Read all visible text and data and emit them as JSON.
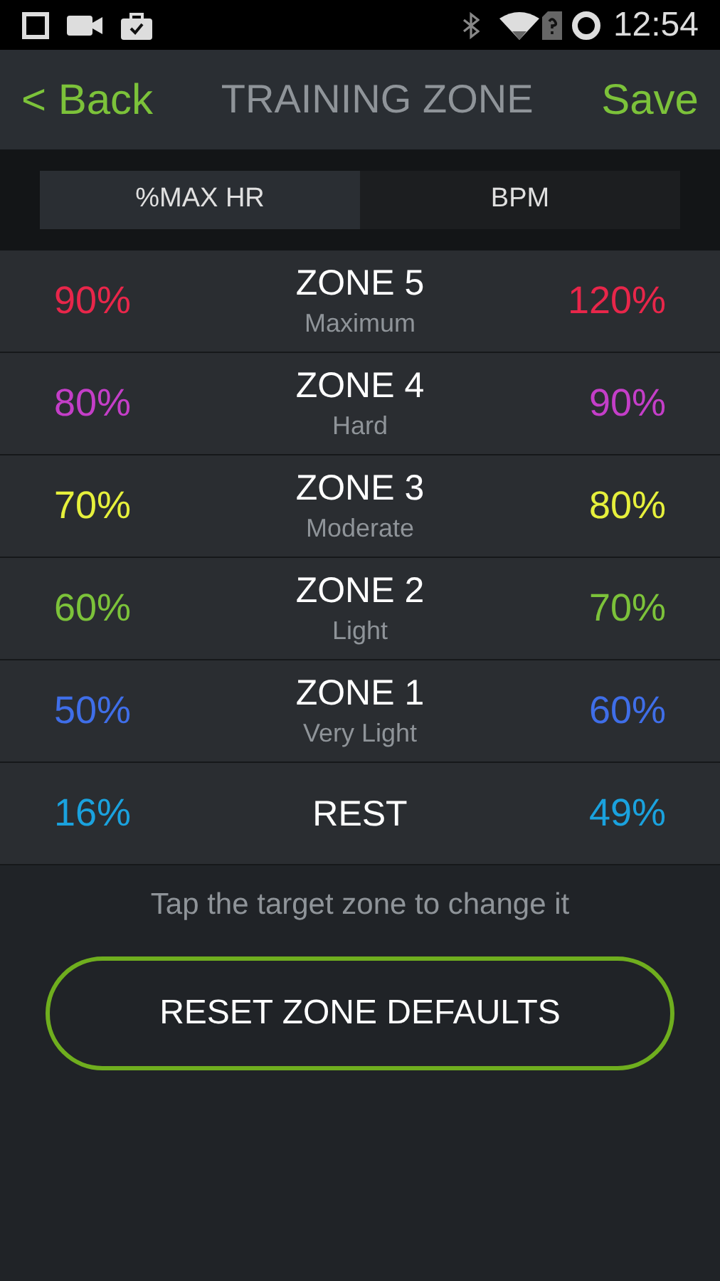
{
  "status_bar": {
    "time": "12:54"
  },
  "header": {
    "back": "< Back",
    "title": "TRAINING ZONE",
    "save": "Save"
  },
  "tabs": [
    {
      "label": "%MAX HR",
      "selected": true
    },
    {
      "label": "BPM",
      "selected": false
    }
  ],
  "zones": [
    {
      "low": "90%",
      "name": "ZONE 5",
      "subtitle": "Maximum",
      "high": "120%",
      "color": "#e8264a"
    },
    {
      "low": "80%",
      "name": "ZONE 4",
      "subtitle": "Hard",
      "high": "90%",
      "color": "#c43ec8"
    },
    {
      "low": "70%",
      "name": "ZONE 3",
      "subtitle": "Moderate",
      "high": "80%",
      "color": "#e6f03c"
    },
    {
      "low": "60%",
      "name": "ZONE 2",
      "subtitle": "Light",
      "high": "70%",
      "color": "#7cc23a"
    },
    {
      "low": "50%",
      "name": "ZONE 1",
      "subtitle": "Very Light",
      "high": "60%",
      "color": "#3f6ee8"
    },
    {
      "low": "16%",
      "name": "REST",
      "high": "49%",
      "color": "#1aa2de"
    }
  ],
  "hint": "Tap the target zone to change it",
  "reset_button": "RESET ZONE DEFAULTS"
}
